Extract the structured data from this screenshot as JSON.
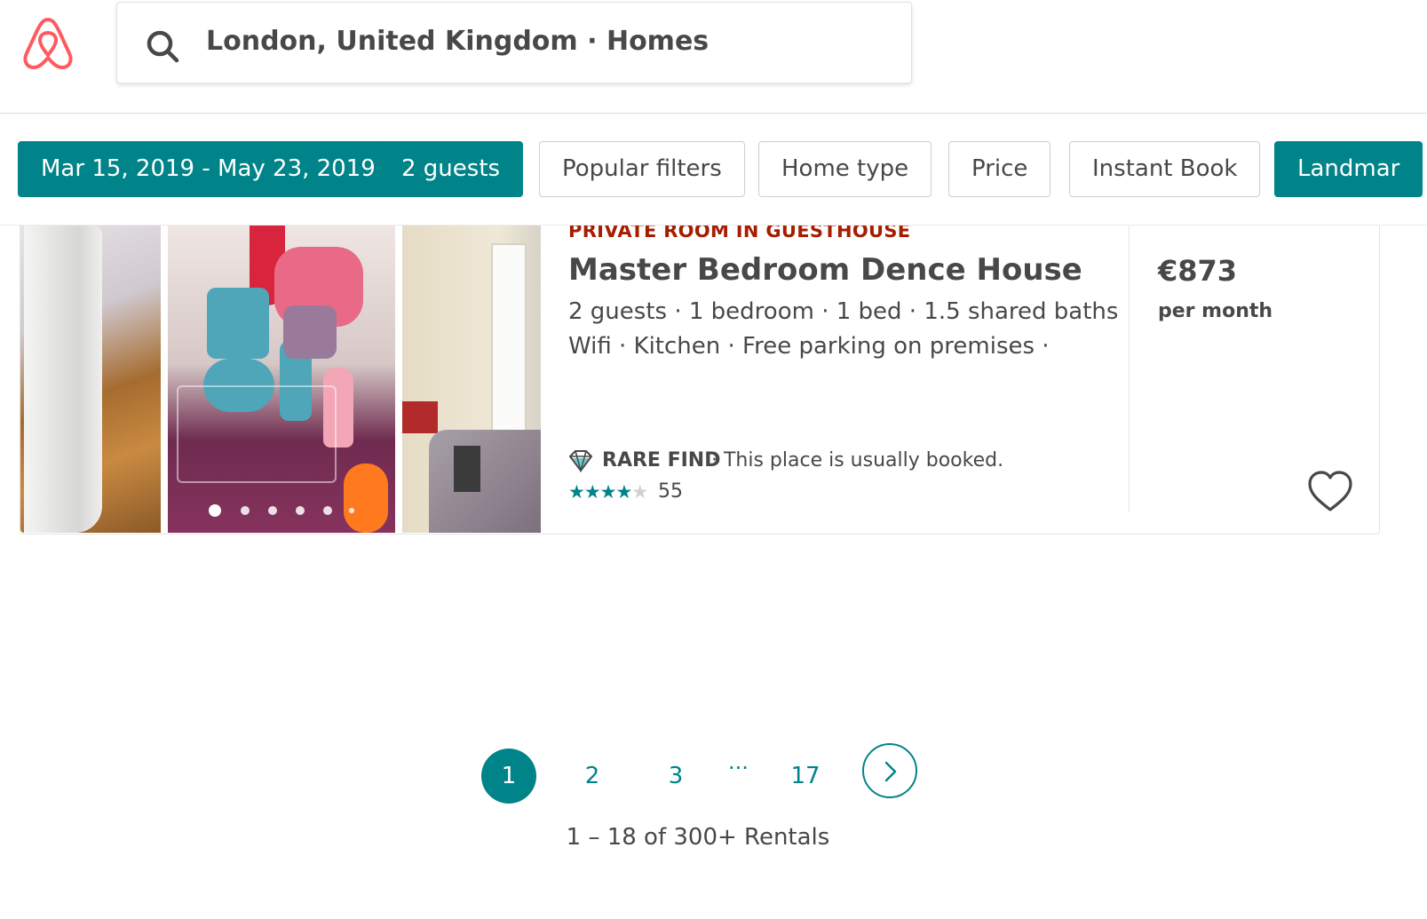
{
  "search": {
    "query": "London, United Kingdom · Homes"
  },
  "filters": [
    {
      "label": "Mar 15, 2019 - May 23, 2019",
      "active": true
    },
    {
      "label": "2 guests",
      "active": true
    },
    {
      "label": "Popular filters",
      "active": false
    },
    {
      "label": "Home type",
      "active": false
    },
    {
      "label": "Price",
      "active": false
    },
    {
      "label": "Instant Book",
      "active": false
    },
    {
      "label": "Landmar",
      "active": true
    }
  ],
  "listing": {
    "kind": "PRIVATE ROOM IN GUESTHOUSE",
    "title": "Master Bedroom Dence House",
    "details": "2 guests · 1 bedroom · 1 bed · 1.5 shared baths",
    "amenities": "Wifi · Kitchen · Free parking on premises ·",
    "rare_label": "RARE FIND",
    "rare_text": " · This place is usually booked.",
    "rating_stars": 4,
    "rating_max": 5,
    "reviews": "55",
    "price": "€873",
    "price_period": "per month",
    "photo_count_dots": 6,
    "active_photo": 1
  },
  "pagination": {
    "pages": [
      "1",
      "2",
      "3"
    ],
    "ellipsis": "···",
    "last_page": "17",
    "current": "1"
  },
  "results_text": "1 – 18 of 300+ Rentals",
  "colors": {
    "accent": "#008489",
    "brand": "#FF5A5F",
    "kind_label": "#A61D00",
    "text": "#484848"
  }
}
